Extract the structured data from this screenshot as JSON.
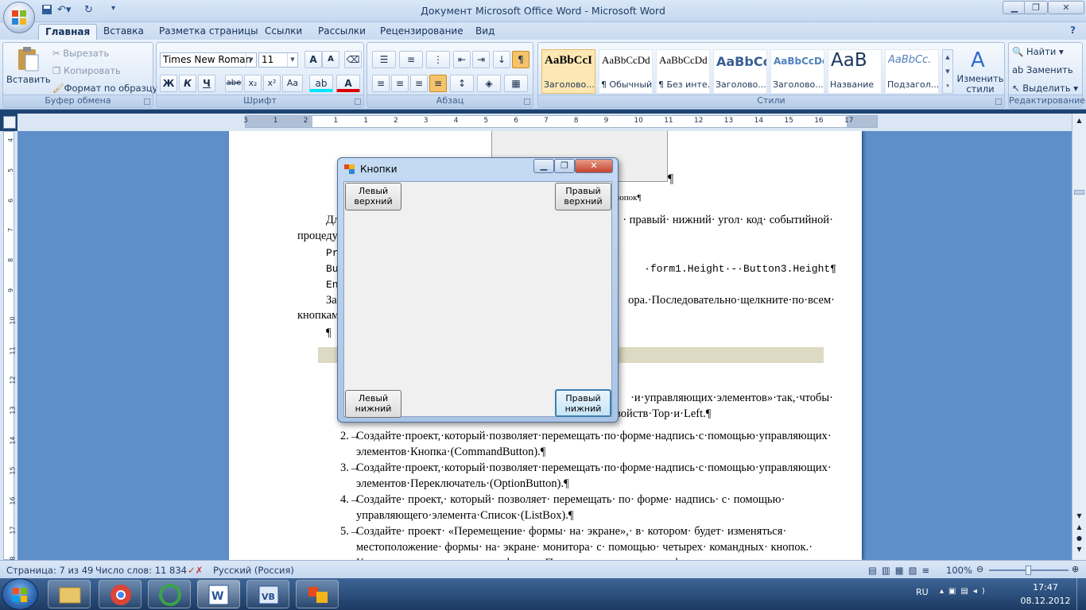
{
  "window": {
    "title": "Документ Microsoft Office Word - Microsoft Word"
  },
  "tabs": [
    {
      "label": "Главная",
      "active": true
    },
    {
      "label": "Вставка"
    },
    {
      "label": "Разметка страницы"
    },
    {
      "label": "Ссылки"
    },
    {
      "label": "Рассылки"
    },
    {
      "label": "Рецензирование"
    },
    {
      "label": "Вид"
    }
  ],
  "clipboard": {
    "paste": "Вставить",
    "cut": "Вырезать",
    "copy": "Копировать",
    "format_painter": "Формат по образцу",
    "label": "Буфер обмена"
  },
  "font": {
    "name": "Times New Roman",
    "size": "11",
    "label": "Шрифт",
    "bold": "Ж",
    "italic": "К",
    "underline": "Ч",
    "strike": "abe",
    "sub": "x₂",
    "sup": "x²",
    "case": "Aa",
    "grow": "A",
    "shrink": "A"
  },
  "paragraph": {
    "label": "Абзац",
    "pilcrow": "¶"
  },
  "styles": {
    "label": "Стили",
    "change": "Изменить стили",
    "items": [
      {
        "preview": "AaBbCcI",
        "name": "Заголово..."
      },
      {
        "preview": "AaBbCcDd",
        "name": "¶ Обычный"
      },
      {
        "preview": "AaBbCcDd",
        "name": "¶ Без инте..."
      },
      {
        "preview": "AaBbCc",
        "name": "Заголово..."
      },
      {
        "preview": "AaBbCcDd",
        "name": "Заголово..."
      },
      {
        "preview": "AaB",
        "name": "Название"
      },
      {
        "preview": "AaBbCc.",
        "name": "Подзагол..."
      }
    ]
  },
  "editing": {
    "label": "Редактирование",
    "find": "Найти",
    "replace": "Заменить",
    "select": "Выделить"
  },
  "ruler": {
    "numbers": [
      "3",
      "1",
      "2",
      "1",
      "1",
      "2",
      "3",
      "4",
      "5",
      "6",
      "7",
      "8",
      "9",
      "10",
      "11",
      "12",
      "13",
      "14",
      "15",
      "16",
      "17"
    ]
  },
  "vruler": {
    "numbers": [
      "4",
      "5",
      "6",
      "7",
      "8",
      "9",
      "10",
      "11",
      "12",
      "13",
      "14",
      "15",
      "16",
      "17",
      "18"
    ]
  },
  "document": {
    "caption": "кнопок¶",
    "l1a": "Дл",
    "l1b": "· правый· нижний· угол· код· событийной·",
    "l2": "процеду",
    "l3": "Pr",
    "l4a": "Bu",
    "l4b": "·form1.Height·-·Button3.Height¶",
    "l5": "En",
    "l6a": "За",
    "l6b": "ора.·Последовательно·щелкните·по·всем·",
    "l7": "кнопкам",
    "l8": "¶",
    "l9": "·и·управляющих·элементов»·так,·чтобы·",
    "l10": "войств·Top·и·Left.¶",
    "items": [
      {
        "num": "2.→",
        "a": "Создайте·проект,·который·позволяет·перемещать·по·форме·надпись·с·помощью·управляющих·",
        "b": "элементов·Кнопка·(CommandButton).¶"
      },
      {
        "num": "3.→",
        "a": "Создайте·проект,·который·позволяет·перемещать·по·форме·надпись·с·помощью·управляющих·",
        "b": "элементов·Переключатель·(OptionButton).¶"
      },
      {
        "num": "4.→",
        "a": "Создайте·  проект,·  который·  позволяет·  перемещать·  по·  форме·  надпись·  с·  помощью·",
        "b": "управляющего·элемента·Список·(ListBox).¶"
      },
      {
        "num": "5.→",
        "a": "Создайте·  проект·  «Перемещение·  формы·  на·  экране»,·  в·  котором·  будет·  изменяться·",
        "b": "местоположение·  формы·  на·  экране·  монитора·  с·  помощью·  четырех·  командных·  кнопок.·",
        "c": "Кнопки·расположить·в·углах·формы.·После·щелчка·по·кнопке·форма·должна·переместиться·"
      }
    ]
  },
  "dialog": {
    "title": "Кнопки",
    "tl": "Левый верхний",
    "tr": "Правый верхний",
    "bl": "Левый нижний",
    "br": "Правый нижний"
  },
  "status": {
    "page": "Страница: 7 из 49",
    "words": "Число слов: 11 834",
    "lang": "Русский (Россия)",
    "zoom": "100%"
  },
  "tray": {
    "lang": "RU",
    "time": "17:47",
    "date": "08.12.2012"
  }
}
